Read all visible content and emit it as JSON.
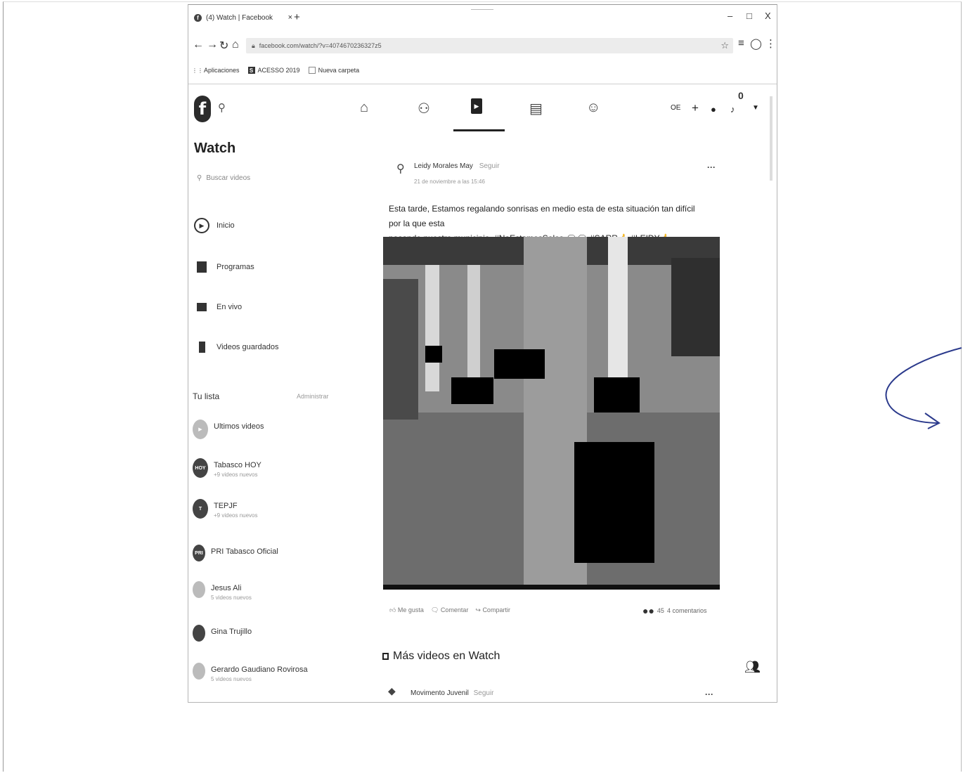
{
  "browser": {
    "tab_title": "(4) Watch | Facebook",
    "tab_close": "×",
    "new_tab": "+",
    "win_min": "–",
    "win_max": "□",
    "win_close": "X",
    "url": "facebook.com/watch/?v=4074670236327z5",
    "bookmarks": [
      {
        "icon": "apps-grid-icon",
        "label": "Aplicaciones"
      },
      {
        "icon": "bookmark-icon",
        "label": "ACESSO 2019"
      },
      {
        "icon": "folder-icon",
        "label": "Nueva carpeta"
      }
    ]
  },
  "fb_header": {
    "logo": "f",
    "notif_count": "0",
    "user_initials": "OE",
    "plus": "+"
  },
  "sidebar": {
    "title": "Watch",
    "search_placeholder": "Buscar videos",
    "items": [
      {
        "icon": "play-icon",
        "label": "Inicio"
      },
      {
        "icon": "programs-icon",
        "label": "Programas"
      },
      {
        "icon": "live-icon",
        "label": "En vivo"
      },
      {
        "icon": "saved-icon",
        "label": "Videos guardados"
      }
    ],
    "list_title": "Tu lista",
    "manage": "Administrar",
    "subscriptions": [
      {
        "name": "Ultimos videos",
        "meta": ""
      },
      {
        "name": "Tabasco HOY",
        "meta": "+9 videos nuevos"
      },
      {
        "name": "TEPJF",
        "meta": "+9 videos nuevos"
      },
      {
        "name": "PRI Tabasco Oficial",
        "meta": ""
      },
      {
        "name": "Jesus Ali",
        "meta": "5 videos nuevos"
      },
      {
        "name": "Gina Trujillo",
        "meta": ""
      },
      {
        "name": "Gerardo Gaudiano Rovirosa",
        "meta": "5 videos nuevos"
      }
    ]
  },
  "post": {
    "author": "Leidy Morales May",
    "follow": "Seguir",
    "date": "21 de noviembre a las 15:46",
    "more": "···",
    "text_line1": "Esta tarde, Estamos regalando sonrisas en medio esta de esta situación tan difícil por la que esta",
    "text_line2": "pasando nuestro municipio. #NoEstamosSolos 🗨🗨 #SARR👍 #LEIDY👍",
    "actions": [
      "Me gusta",
      "Comentar",
      "Compartir"
    ],
    "reactions_count": "45",
    "comments_count": "4 comentarios"
  },
  "more_videos": {
    "title": "Más videos en Watch",
    "next_author": "Movimento Juvenil",
    "next_follow": "Seguir",
    "more": "···"
  }
}
